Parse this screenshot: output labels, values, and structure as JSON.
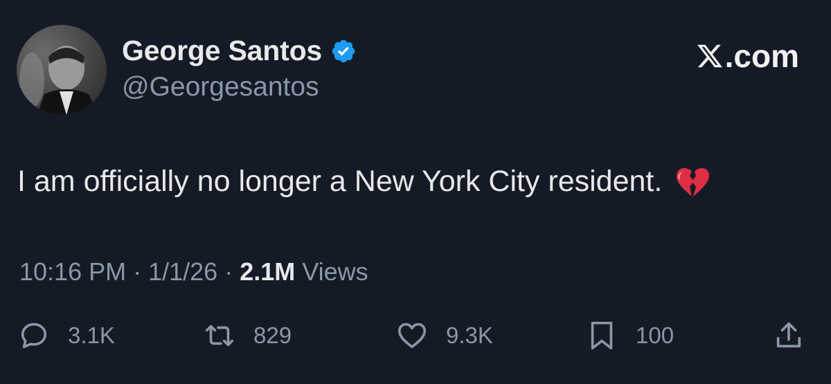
{
  "author": {
    "display_name": "George Santos",
    "handle": "@Georgesantos",
    "verified_icon": "verified-badge-icon",
    "verified_color": "#1d9bf0"
  },
  "brand": {
    "text": ".com",
    "icon": "x-logo-icon"
  },
  "tweet": {
    "text": "I am officially no longer a New York City resident.",
    "emoji_icon": "broken-heart-icon"
  },
  "meta": {
    "time": "10:16 PM",
    "sep1": " · ",
    "date": "1/1/26",
    "sep2": " · ",
    "views_count": "2.1M",
    "views_label": " Views"
  },
  "actions": {
    "replies": "3.1K",
    "reposts": "829",
    "likes": "9.3K",
    "bookmarks": "100"
  },
  "colors": {
    "background": "#151b26",
    "text_primary": "#e7e9ea",
    "text_secondary": "#8b98a5",
    "accent": "#1d9bf0"
  }
}
